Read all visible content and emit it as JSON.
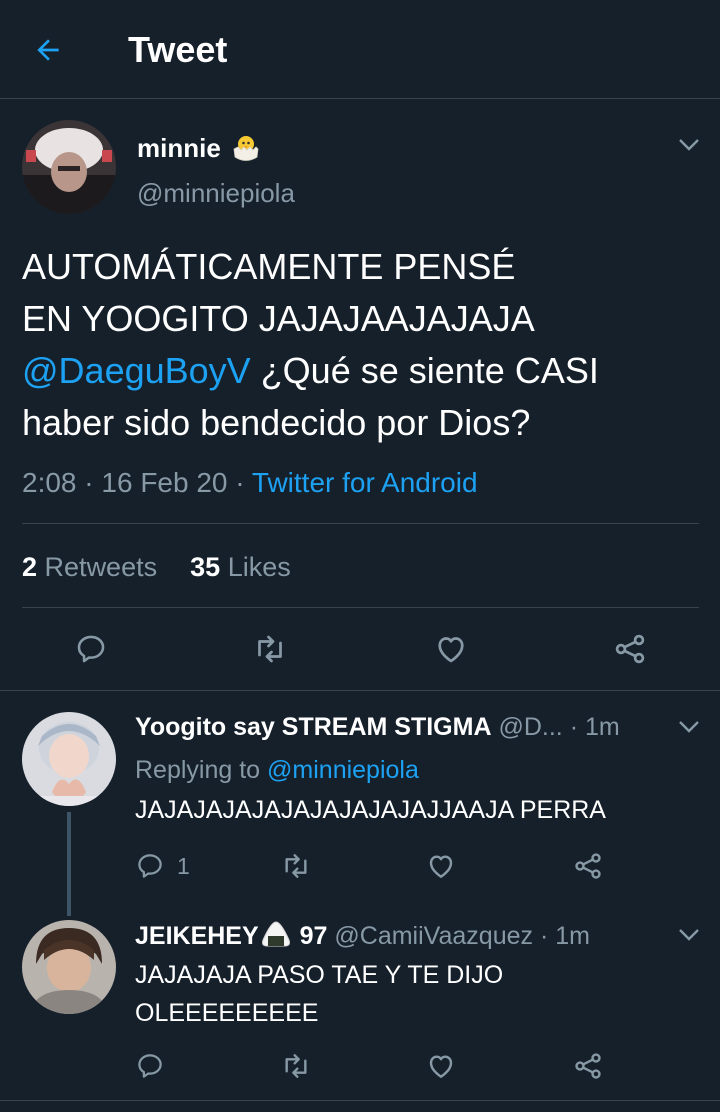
{
  "header": {
    "title": "Tweet"
  },
  "main_tweet": {
    "display_name": "minnie",
    "handle": "@minniepiola",
    "text_line1": "AUTOMÁTICAMENTE PENSÉ",
    "text_line2": "EN YOOGITO JAJAJAAJAJAJA",
    "mention": "@DaeguBoyV",
    "text_line3_rest": " ¿Qué se siente CASI",
    "text_line4": "haber sido bendecido por Dios?",
    "time": "2:08",
    "date": "16 Feb 20",
    "source": "Twitter for Android",
    "retweet_count": "2",
    "retweet_label": "Retweets",
    "like_count": "35",
    "like_label": "Likes"
  },
  "replies": [
    {
      "display_name": "Yoogito say STREAM STIGMA",
      "handle": "@D...",
      "time": "1m",
      "replying_label": "Replying to",
      "replying_to": "@minniepiola",
      "text_line1": "JAJAJAJAJAJAJAJAJAJAJJAAJA PERRA",
      "reply_count": "1"
    },
    {
      "display_name": "JEIKEHEY",
      "name_suffix": "97",
      "handle": "@CamiiVaazquez",
      "time": "1m",
      "text_line1": "JAJAJAJA PASO TAE Y TE DIJO",
      "text_line2": "OLEEEEEEEEE"
    }
  ],
  "colors": {
    "background": "#15202b",
    "accent": "#1da1f2",
    "muted": "#8899a6",
    "divider": "#38444d"
  },
  "icons": [
    "back-arrow-icon",
    "chevron-down-icon",
    "reply-icon",
    "retweet-icon",
    "like-icon",
    "share-icon",
    "hatching-chick-emoji",
    "onigiri-emoji"
  ]
}
